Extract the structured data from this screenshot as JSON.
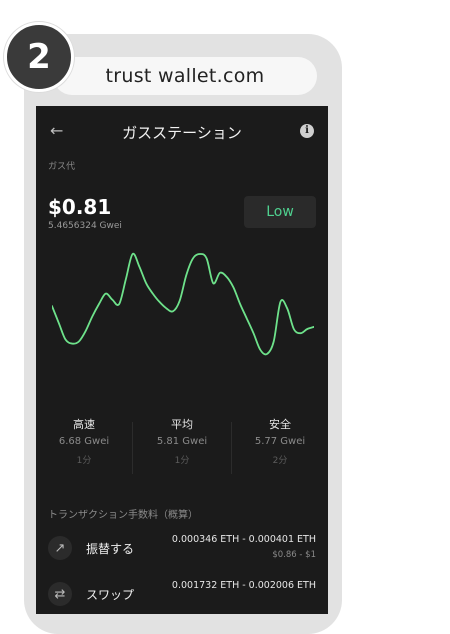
{
  "step": "2",
  "browser": {
    "url": "trust wallet.com"
  },
  "nav": {
    "title": "ガスステーション",
    "back_icon": "arrow-left-icon",
    "info_icon": "info-icon"
  },
  "gas": {
    "label": "ガス代",
    "price": "$0.81",
    "gwei": "5.4656324 Gwei",
    "status": "Low",
    "status_color": "#4fd08f"
  },
  "chart_data": {
    "type": "line",
    "y": [
      50,
      34,
      18,
      14,
      16,
      26,
      40,
      52,
      62,
      56,
      52,
      76,
      100,
      88,
      72,
      62,
      54,
      48,
      45,
      55,
      80,
      96,
      100,
      96,
      72,
      82,
      78,
      68,
      52,
      38,
      24,
      8,
      4,
      16,
      54,
      48,
      28,
      24,
      28,
      30
    ],
    "color": "#6ee28b"
  },
  "speeds": [
    {
      "name": "高速",
      "gwei": "6.68 Gwei",
      "time": "1分"
    },
    {
      "name": "平均",
      "gwei": "5.81 Gwei",
      "time": "1分"
    },
    {
      "name": "安全",
      "gwei": "5.77 Gwei",
      "time": "2分"
    }
  ],
  "fees": {
    "header": "トランザクション手数料（概算）",
    "rows": [
      {
        "icon": "arrow-up-right-icon",
        "name": "振替する",
        "eth": "0.000346 ETH - 0.000401 ETH",
        "usd": "$0.86 - $1"
      },
      {
        "icon": "swap-icon",
        "name": "スワップ",
        "eth": "0.001732 ETH - 0.002006 ETH",
        "usd": ""
      }
    ]
  }
}
